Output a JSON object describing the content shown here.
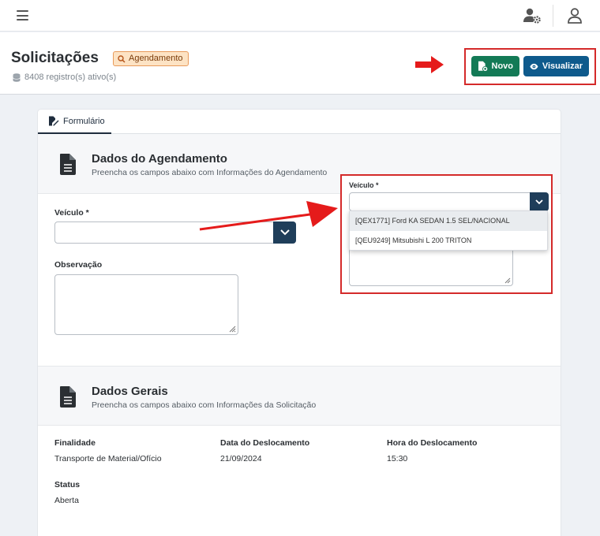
{
  "topbar": {
    "menu_icon": "hamburger-icon",
    "user_settings_icon": "user-gear-icon",
    "user_icon": "user-icon"
  },
  "header": {
    "title": "Solicitações",
    "badge": "Agendamento",
    "records": "8408 registro(s) ativo(s)",
    "buttons": {
      "novo": "Novo",
      "visualizar": "Visualizar"
    }
  },
  "tabs": [
    {
      "label": "Formulário",
      "icon": "file-edit-icon"
    }
  ],
  "agendamento": {
    "title": "Dados do Agendamento",
    "subtitle": "Preencha os campos abaixo com Informações do Agendamento",
    "veiculo_label": "Veículo *",
    "veiculo_value": "",
    "observacao_label": "Observação",
    "observacao_value": ""
  },
  "zoom": {
    "veiculo_label": "Veículo *",
    "options": [
      "[QEX1771] Ford KA SEDAN 1.5 SEL/NACIONAL",
      "[QEU9249] Mitsubishi L 200 TRITON"
    ]
  },
  "gerais": {
    "title": "Dados Gerais",
    "subtitle": "Preencha os campos abaixo com Informações da Solicitação",
    "finalidade_label": "Finalidade",
    "finalidade_value": "Transporte de Material/Ofício",
    "data_label": "Data do Deslocamento",
    "data_value": "21/09/2024",
    "hora_label": "Hora do Deslocamento",
    "hora_value": "15:30",
    "status_label": "Status",
    "status_value": "Aberta"
  },
  "colors": {
    "primary_green": "#137a56",
    "primary_blue": "#0e5a8c",
    "annotation_red": "#d42a2a",
    "badge_bg": "#fde3c4"
  }
}
